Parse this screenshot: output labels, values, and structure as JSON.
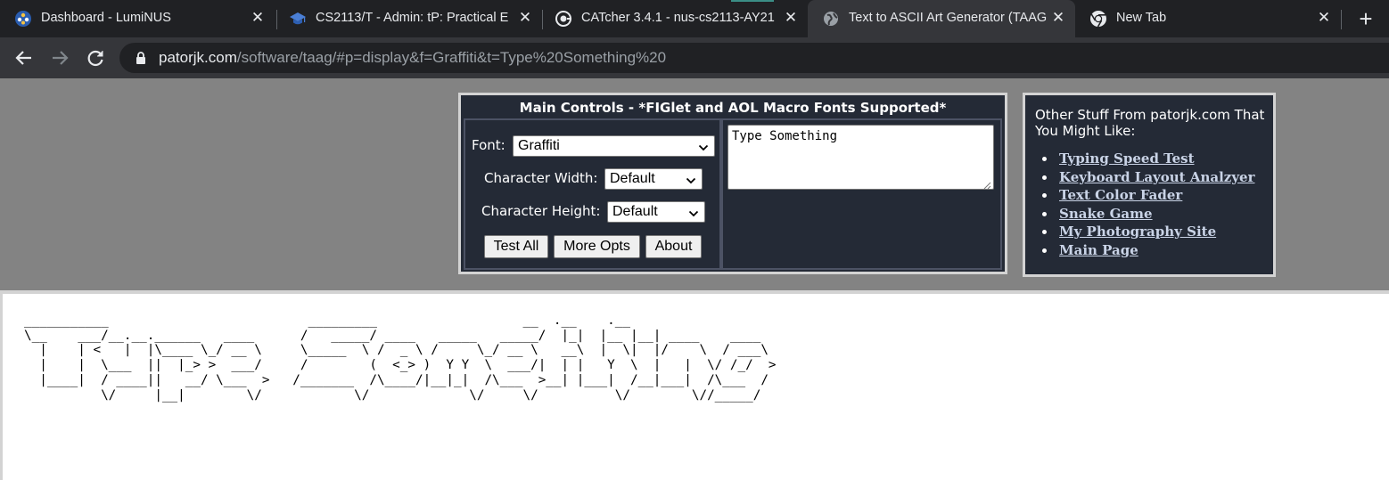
{
  "browser": {
    "tabs": [
      {
        "title": "Dashboard - LumiNUS",
        "icon": "luminus-icon",
        "active": false
      },
      {
        "title": "CS2113/T - Admin: tP: Practical E",
        "icon": "graduation-cap-icon",
        "active": false
      },
      {
        "title": "CATcher 3.4.1 - nus-cs2113-AY21",
        "icon": "catcher-icon",
        "active": false
      },
      {
        "title": "Text to ASCII Art Generator (TAAG",
        "icon": "globe-icon",
        "active": true
      },
      {
        "title": "New Tab",
        "icon": "chrome-icon",
        "active": false
      }
    ],
    "url_host": "patorjk.com",
    "url_path": "/software/taag/#p=display&f=Graffiti&t=Type%20Something%20"
  },
  "main_controls": {
    "header": "Main Controls - *FIGlet and AOL Macro Fonts Supported*",
    "font_label": "Font:",
    "font_value": "Graffiti",
    "char_width_label": "Character Width:",
    "char_width_value": "Default",
    "char_height_label": "Character Height:",
    "char_height_value": "Default",
    "test_all_label": "Test All",
    "more_opts_label": "More Opts",
    "about_label": "About",
    "input_text": "Type Something"
  },
  "other_stuff": {
    "intro": "Other Stuff From patorjk.com That You Might Like:",
    "links": [
      "Typing Speed Test",
      "Keyboard Layout Analzyer",
      "Text Color Fader",
      "Snake Game",
      "My Photography Site",
      "Main Page"
    ]
  },
  "output": {
    "ascii_art": "___________                          _________                   __  .__    .__\n\\__    ___/__.__.______   ____      /   _____/ ____   _____   _____/  |_|  |__ |__| ____    ____\n  |    | <   |  |\\____ \\_/ __ \\     \\_____  \\ /  _ \\ /     \\_/ __ \\   __\\  |  \\|  |/    \\  / ___\\\n  |    |  \\___  ||  |_> >  ___/     /        (  <_> )  Y Y  \\  ___/|  | |   Y  \\  |   |  \\/ /_/  >\n  |____|  / ____||   __/ \\___  >   /_______  /\\____/|__|_|  /\\___  >__| |___|  /__|___|  /\\___  /\n          \\/     |__|        \\/            \\/             \\/     \\/          \\/        \\//_____/"
  },
  "colors": {
    "tabstrip": "#202124",
    "active_tab": "#35363a",
    "page_gray": "#838383",
    "panel_bg": "#242a36",
    "link": "#c9d3e6"
  }
}
